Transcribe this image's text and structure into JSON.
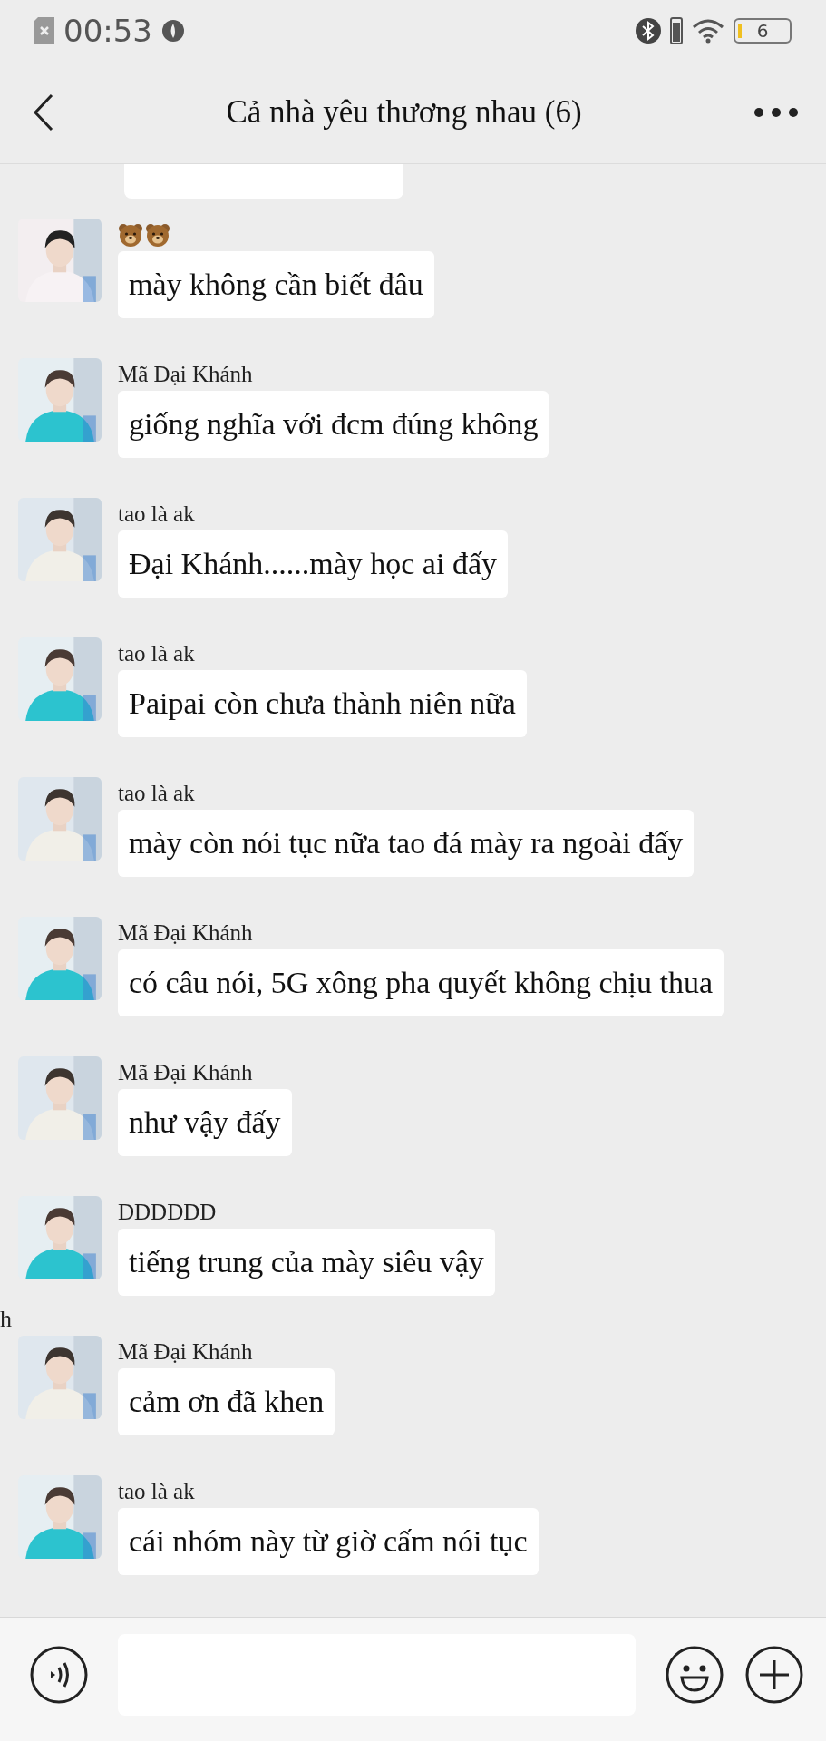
{
  "status_bar": {
    "time": "00:53",
    "battery": "6"
  },
  "header": {
    "title": "Cả nhà yêu thương nhau (6)"
  },
  "stray_text": "h",
  "messages": [
    {
      "kind": "bears",
      "text": "mày không cần biết đâu"
    },
    {
      "sender": "Mã Đại Khánh",
      "text": "giống nghĩa với đcm đúng không"
    },
    {
      "sender": "tao là ak",
      "text": "Đại Khánh......mày học ai đấy"
    },
    {
      "sender": "tao là ak",
      "text": "Paipai còn chưa thành niên nữa"
    },
    {
      "sender": "tao là ak",
      "text": "mày còn nói tục nữa tao đá mày ra ngoài đấy"
    },
    {
      "sender": "Mã Đại Khánh",
      "text": "có câu nói, 5G xông pha quyết không chịu thua"
    },
    {
      "sender": "Mã Đại Khánh",
      "text": "như vậy đấy"
    },
    {
      "sender": "DDDDDD",
      "text": "tiếng trung của mày siêu vậy"
    },
    {
      "sender": "Mã Đại Khánh",
      "text": "cảm ơn đã khen"
    },
    {
      "sender": "tao là ak",
      "text": "cái nhóm này từ giờ cấm nói tục"
    }
  ]
}
